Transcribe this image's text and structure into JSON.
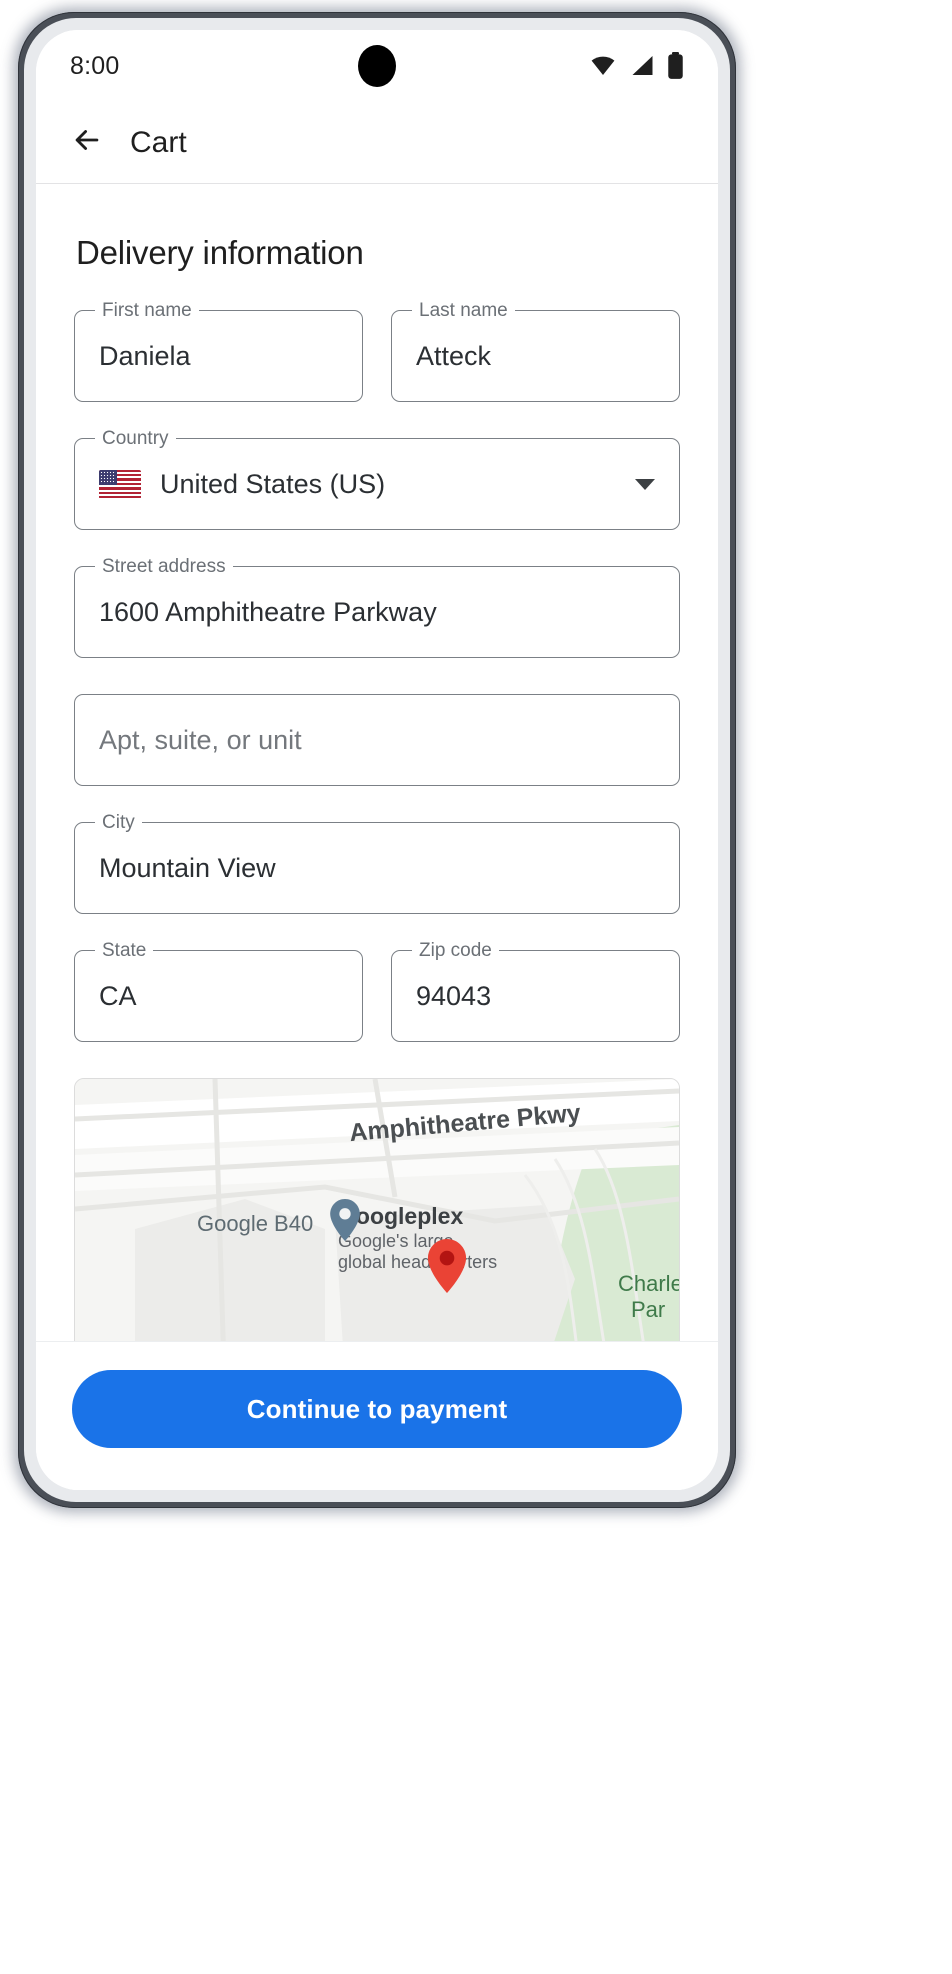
{
  "status_bar": {
    "time": "8:00",
    "icons": [
      "wifi-icon",
      "cellular-signal-icon",
      "battery-icon"
    ]
  },
  "app_bar": {
    "back_icon": "arrow-back-icon",
    "title": "Cart"
  },
  "main": {
    "section_title": "Delivery information",
    "fields": {
      "first_name": {
        "label": "First name",
        "value": "Daniela"
      },
      "last_name": {
        "label": "Last name",
        "value": "Atteck"
      },
      "country": {
        "label": "Country",
        "value": "United States (US)",
        "flag": "us-flag-icon",
        "arrow": "chevron-down-icon"
      },
      "street": {
        "label": "Street address",
        "value": "1600 Amphitheatre Parkway"
      },
      "apt": {
        "label": "",
        "placeholder": "Apt, suite, or unit",
        "value": ""
      },
      "city": {
        "label": "City",
        "value": "Mountain View"
      },
      "state": {
        "label": "State",
        "value": "CA"
      },
      "zip": {
        "label": "Zip code",
        "value": "94043"
      }
    },
    "map": {
      "street_label": "Amphitheatre Pkwy",
      "building_label": "Google B40",
      "poi_title": "Googleplex",
      "poi_sub_line1": "Google's large",
      "poi_sub_line2": "global headquarters",
      "park_line1": "Charle",
      "park_line2": "Par",
      "marker_primary": "map-pin-red",
      "marker_secondary": "map-pin-blue"
    }
  },
  "bottom_bar": {
    "cta_label": "Continue to payment"
  },
  "colors": {
    "accent": "#1a73e8",
    "field_border": "#7b8086",
    "text_primary": "#1f1f1f",
    "text_secondary": "#6b7076"
  }
}
